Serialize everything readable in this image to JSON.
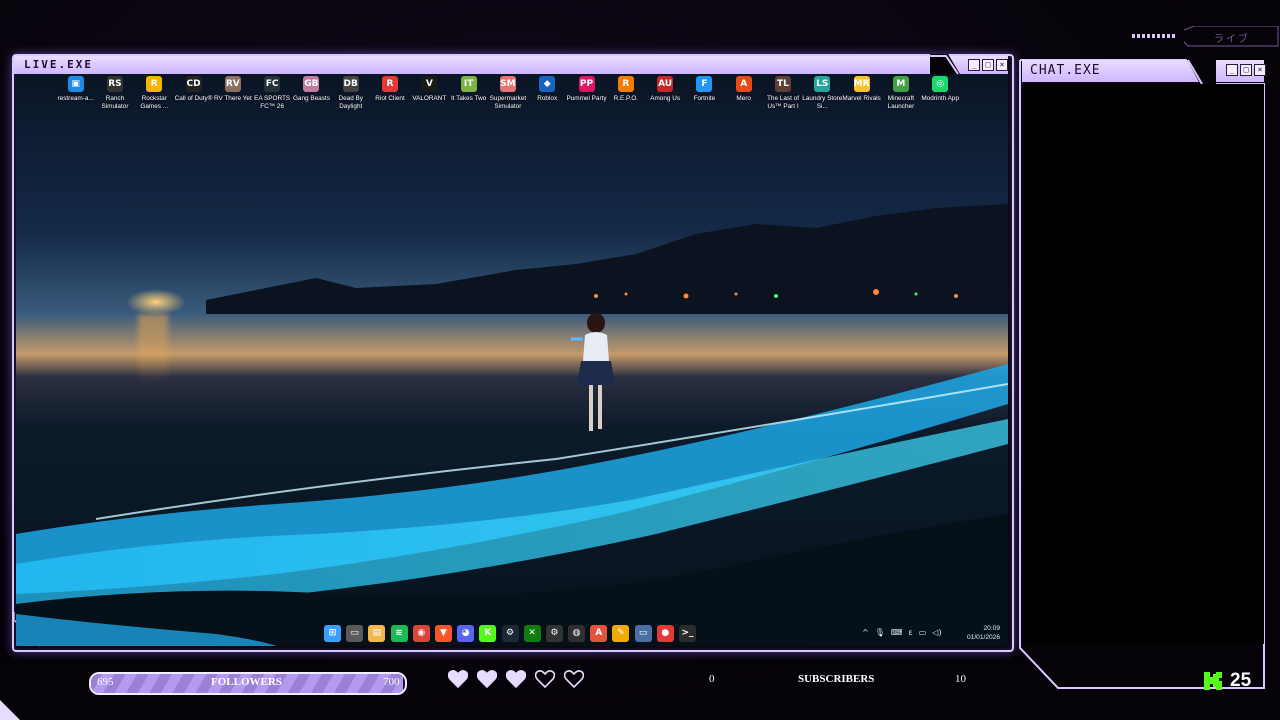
{
  "live_window": {
    "title": "LIVE.EXE",
    "buttons": [
      "_",
      "□",
      "×"
    ]
  },
  "desktop_icons": [
    {
      "label": "restream-a...",
      "color": "#1e88e5",
      "glyph": "▣"
    },
    {
      "label": "Ranch Simulator",
      "color": "#333333",
      "glyph": "RS"
    },
    {
      "label": "Rockstar Games ...",
      "color": "#f4b400",
      "glyph": "R"
    },
    {
      "label": "Call of Duty®",
      "color": "#222222",
      "glyph": "CD"
    },
    {
      "label": "RV There Yet",
      "color": "#8d6e63",
      "glyph": "RV"
    },
    {
      "label": "EA SPORTS FC™ 26",
      "color": "#263238",
      "glyph": "FC"
    },
    {
      "label": "Gang Beasts",
      "color": "#c27ba0",
      "glyph": "GB"
    },
    {
      "label": "Dead By Daylight",
      "color": "#424242",
      "glyph": "DB"
    },
    {
      "label": "Riot Client",
      "color": "#e53935",
      "glyph": "R"
    },
    {
      "label": "VALORANT",
      "color": "#1a1a1a",
      "glyph": "V"
    },
    {
      "label": "It Takes Two",
      "color": "#7cb342",
      "glyph": "IT"
    },
    {
      "label": "Supermarket Simulator",
      "color": "#e57373",
      "glyph": "SM"
    },
    {
      "label": "Roblox",
      "color": "#1565c0",
      "glyph": "◆"
    },
    {
      "label": "Pummel Party",
      "color": "#d81b60",
      "glyph": "PP"
    },
    {
      "label": "R.E.P.O.",
      "color": "#f57c00",
      "glyph": "R"
    },
    {
      "label": "Among Us",
      "color": "#c62828",
      "glyph": "AU"
    },
    {
      "label": "Fortnite",
      "color": "#2196f3",
      "glyph": "F"
    },
    {
      "label": "Mero",
      "color": "#e64a19",
      "glyph": "A"
    },
    {
      "label": "The Last of Us™ Part I",
      "color": "#5d4037",
      "glyph": "TL"
    },
    {
      "label": "Laundry Store Si...",
      "color": "#26a69a",
      "glyph": "LS"
    },
    {
      "label": "Marvel Rivals",
      "color": "#fbc02d",
      "glyph": "MR"
    },
    {
      "label": "Minecraft Launcher",
      "color": "#43a047",
      "glyph": "M"
    },
    {
      "label": "Modrinth App",
      "color": "#1bd96a",
      "glyph": "◎"
    }
  ],
  "taskbar": {
    "icons": [
      {
        "name": "windows-start-icon",
        "color": "#3aa0ff",
        "glyph": "⊞"
      },
      {
        "name": "task-view-icon",
        "color": "#5a5a5a",
        "glyph": "▭"
      },
      {
        "name": "file-explorer-icon",
        "color": "#f2b84b",
        "glyph": "▤"
      },
      {
        "name": "spotify-icon",
        "color": "#1db954",
        "glyph": "≋"
      },
      {
        "name": "chrome-icon",
        "color": "#db4437",
        "glyph": "◉"
      },
      {
        "name": "brave-icon",
        "color": "#fb542b",
        "glyph": "▼"
      },
      {
        "name": "discord-icon",
        "color": "#5865f2",
        "glyph": "◕"
      },
      {
        "name": "kick-icon",
        "color": "#53fc18",
        "glyph": "K"
      },
      {
        "name": "steam-icon",
        "color": "#1b2838",
        "glyph": "⚙"
      },
      {
        "name": "xbox-icon",
        "color": "#107c10",
        "glyph": "✕"
      },
      {
        "name": "settings-icon",
        "color": "#333333",
        "glyph": "⚙"
      },
      {
        "name": "obs-icon",
        "color": "#302e31",
        "glyph": "◍"
      },
      {
        "name": "app-a-icon",
        "color": "#e2553a",
        "glyph": "A"
      },
      {
        "name": "app-tool-icon",
        "color": "#f2a900",
        "glyph": "✎"
      },
      {
        "name": "app-monitor-icon",
        "color": "#4a6fa5",
        "glyph": "▭"
      },
      {
        "name": "app-record-icon",
        "color": "#e53935",
        "glyph": "●"
      },
      {
        "name": "terminal-icon",
        "color": "#2b2b2b",
        "glyph": ">_"
      }
    ],
    "tray": [
      "^",
      "🎙",
      "⌨",
      "ε",
      "▭",
      "◁)"
    ],
    "time": "20:09",
    "date": "01/01/2026"
  },
  "chat_window": {
    "title": "CHAT.EXE",
    "buttons": [
      "_",
      "□",
      "×"
    ],
    "deco_text": "ライブ"
  },
  "followers": {
    "current": "695",
    "label": "FOLLOWERS",
    "goal": "700",
    "progress": 0.9929
  },
  "hearts": {
    "filled": 3,
    "total": 5
  },
  "subscribers": {
    "current": "0",
    "label": "SUBSCRIBERS",
    "goal": "10"
  },
  "kick": {
    "count": "25"
  },
  "colors": {
    "accent": "#d9c7ff",
    "fill": "#b39af0",
    "kick_green": "#53fc18"
  }
}
